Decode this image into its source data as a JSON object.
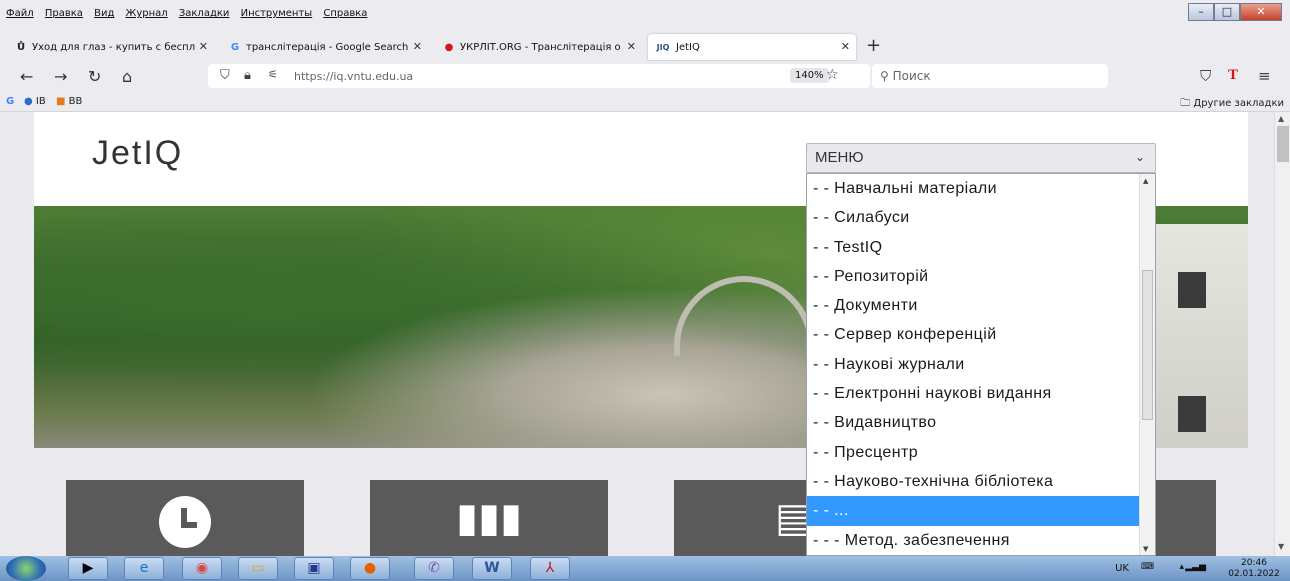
{
  "menubar": {
    "items": [
      "Файл",
      "Правка",
      "Вид",
      "Журнал",
      "Закладки",
      "Инструменты",
      "Справка"
    ]
  },
  "tabs": [
    {
      "label": "Уход для глаз - купить с беспл",
      "icon": "u-favicon-icon"
    },
    {
      "label": "транслітерація - Google Search",
      "icon": "google-icon"
    },
    {
      "label": "УКРЛІТ.ORG - Транслітерація о",
      "icon": "red-dot-icon"
    },
    {
      "label": "JetIQ",
      "icon": "jetiq-favicon-icon",
      "favicon_text": "JIQ"
    }
  ],
  "navbar": {
    "url": "https://iq.vntu.edu.ua",
    "zoom": "140%",
    "search_placeholder": "Поиск"
  },
  "bookmarks": {
    "items": [
      "IB",
      "BB"
    ],
    "other": "Другие закладки"
  },
  "page": {
    "logo": "JetIQ",
    "select_value": "МЕНЮ",
    "options": [
      "- - Навчальні матеріали",
      "- - Силабуси",
      "- - TestIQ",
      "- - Репозиторій",
      "- - Документи",
      "- - Сервер конференцій",
      "- - Наукові журнали",
      "- - Електронні наукові видання",
      "- - Видавництво",
      "- - Пресцентр",
      "- - Науково-технічна бібліотека",
      "- - ...",
      "- - - Метод. забезпечення"
    ],
    "selected_index": 11
  },
  "taskbar": {
    "lang": "UK",
    "time": "20:46",
    "date": "02.01.2022"
  }
}
